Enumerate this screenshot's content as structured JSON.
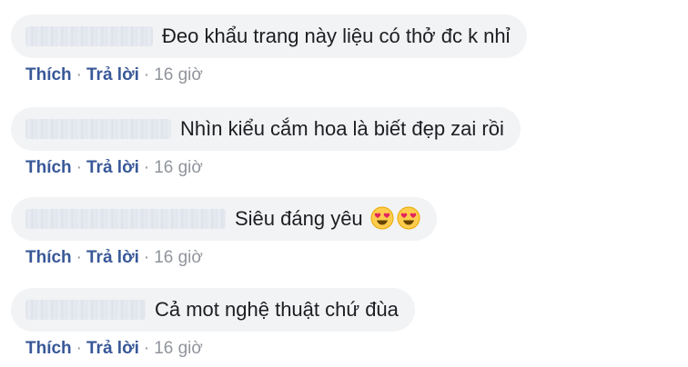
{
  "comments": [
    {
      "text": "Đeo khẩu trang này liệu có thở đc k nhỉ",
      "like": "Thích",
      "reply": "Trả lời",
      "time": "16 giờ",
      "emojis": []
    },
    {
      "text": "Nhìn kiểu cắm hoa là biết đẹp zai rồi",
      "like": "Thích",
      "reply": "Trả lời",
      "time": "16 giờ",
      "emojis": []
    },
    {
      "text": "Siêu đáng yêu",
      "like": "Thích",
      "reply": "Trả lời",
      "time": "16 giờ",
      "emojis": [
        "heart-eyes-emoji",
        "heart-eyes-emoji"
      ]
    },
    {
      "text": "Cả mot nghệ thuật chứ đùa",
      "like": "Thích",
      "reply": "Trả lời",
      "time": "16 giờ",
      "emojis": []
    }
  ],
  "separator": "·",
  "colors": {
    "bubble": "#f2f3f5",
    "link": "#385898",
    "meta": "#90949c",
    "text": "#1c1e21"
  }
}
